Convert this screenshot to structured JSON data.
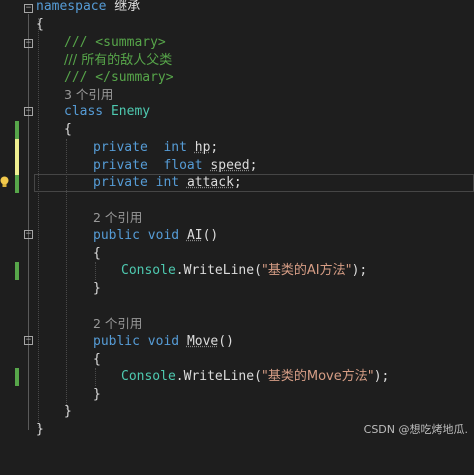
{
  "code": {
    "namespace_kw": "namespace",
    "namespace_name": "继承",
    "open_brace": "{",
    "close_brace": "}",
    "summary_open": "/// <summary>",
    "summary_text": "/// 所有的敌人父类",
    "summary_close": "/// </summary>",
    "class_refs": "3 个引用",
    "class_kw": "class",
    "class_name": "Enemy",
    "field1_mod": "private",
    "field1_type": "int",
    "field1_name": "hp",
    "field2_mod": "private",
    "field2_type": "float",
    "field2_name": "speed",
    "field3_mod": "private",
    "field3_type": "int",
    "field3_name": "attack",
    "semicolon": ";",
    "method1_refs": "2 个引用",
    "method1_mod": "public",
    "method1_ret": "void",
    "method1_name": "AI",
    "method1_parens": "()",
    "method1_console": "Console",
    "method1_call": ".WriteLine(",
    "method1_string": "\"基类的AI方法\"",
    "method1_end": ");",
    "method2_refs": "2 个引用",
    "method2_mod": "public",
    "method2_ret": "void",
    "method2_name": "Move",
    "method2_parens": "()",
    "method2_console": "Console",
    "method2_call": ".WriteLine(",
    "method2_string": "\"基类的Move方法\"",
    "method2_end": ");"
  },
  "watermark": "CSDN @想吃烤地瓜.",
  "colors": {
    "background": "#1e1e1e",
    "keyword": "#569cd6",
    "type": "#4ec9b0",
    "comment": "#57a64a",
    "string": "#d69d85",
    "identifier": "#dcdcdc",
    "reference_lens": "#999999",
    "change_saved": "#57a64a",
    "change_unsaved": "#efef91"
  },
  "icons": [
    "fold-collapse-icon",
    "lightbulb-icon"
  ]
}
